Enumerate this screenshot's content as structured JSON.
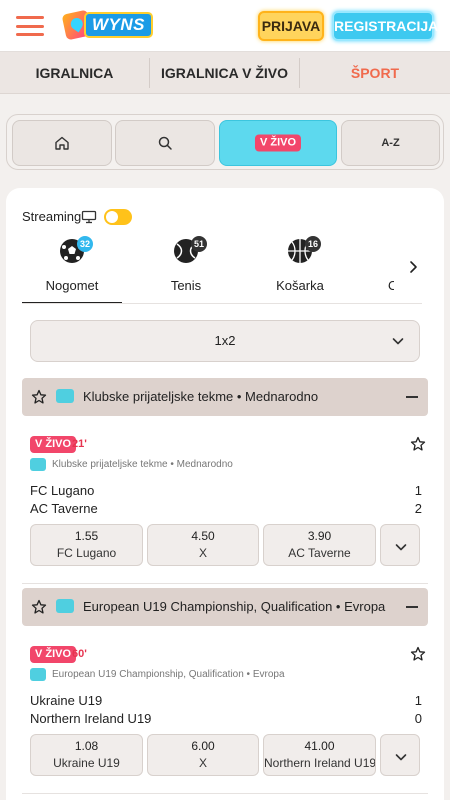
{
  "header": {
    "logo_text": "WYNS",
    "login_label": "PRIJAVA",
    "register_label": "REGISTRACIJA"
  },
  "main_nav": [
    {
      "label": "IGRALNICA",
      "active": false
    },
    {
      "label": "IGRALNICA V ŽIVO",
      "active": false
    },
    {
      "label": "ŠPORT",
      "active": true
    }
  ],
  "filters": {
    "home_icon": "home-icon",
    "search_icon": "search-icon",
    "live_label": "V ŽIVO",
    "az_label": "A-Z",
    "active": "live"
  },
  "streaming": {
    "label": "Streaming",
    "icon": "monitor-icon",
    "enabled": true
  },
  "sports": [
    {
      "label": "Nogomet",
      "count": "32",
      "icon": "soccer-ball-icon",
      "active": true
    },
    {
      "label": "Tenis",
      "count": "51",
      "icon": "tennis-ball-icon",
      "active": false
    },
    {
      "label": "Košarka",
      "count": "16",
      "icon": "basketball-icon",
      "active": false
    },
    {
      "label": "O",
      "count": "",
      "icon": "",
      "active": false
    }
  ],
  "market": {
    "selected": "1x2"
  },
  "leagues": [
    {
      "title": "Klubske prijateljske tekme • Mednarodno",
      "match": {
        "live_label": "V ŽIVO",
        "minute": "21'",
        "competition": "Klubske prijateljske tekme • Mednarodno",
        "home": "FC Lugano",
        "away": "AC Taverne",
        "home_score": "1",
        "away_score": "2",
        "odds": [
          {
            "value": "1.55",
            "label": "FC Lugano"
          },
          {
            "value": "4.50",
            "label": "X"
          },
          {
            "value": "3.90",
            "label": "AC Taverne"
          }
        ]
      }
    },
    {
      "title": "European U19 Championship, Qualification • Evropa",
      "match": {
        "live_label": "V ŽIVO",
        "minute": "60'",
        "competition": "European U19 Championship, Qualification • Evropa",
        "home": "Ukraine U19",
        "away": "Northern Ireland U19",
        "home_score": "1",
        "away_score": "0",
        "odds": [
          {
            "value": "1.08",
            "label": "Ukraine U19"
          },
          {
            "value": "6.00",
            "label": "X"
          },
          {
            "value": "41.00",
            "label": "Northern Ireland U19"
          }
        ]
      }
    }
  ],
  "colors": {
    "accent": "#f06a4d",
    "live": "#f2466a",
    "cyan": "#5dd9ee",
    "toggle": "#ffc21a"
  }
}
